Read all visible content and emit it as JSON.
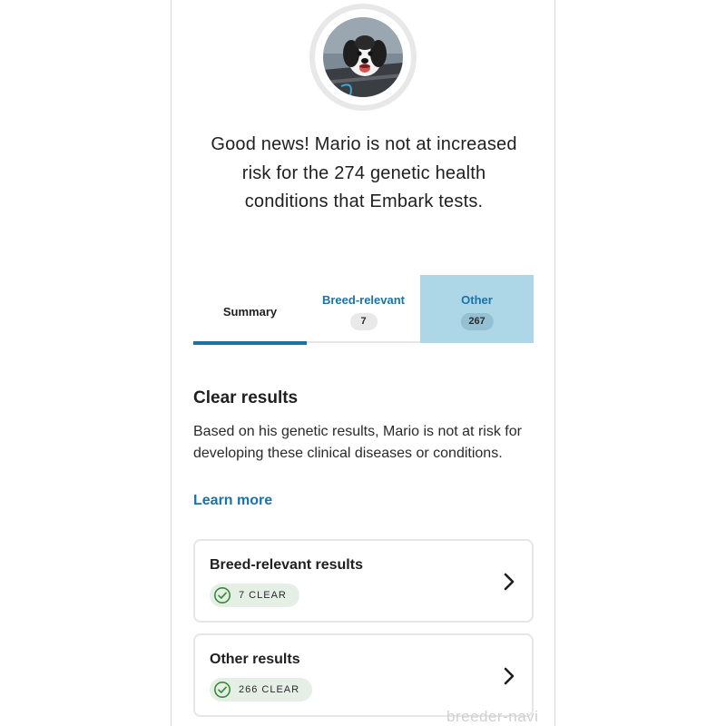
{
  "headline": "Good news! Mario is not at increased risk for the 274 genetic health conditions that Embark tests.",
  "tabs": [
    {
      "label": "Summary",
      "count": ""
    },
    {
      "label": "Breed-relevant",
      "count": "7"
    },
    {
      "label": "Other",
      "count": "267"
    }
  ],
  "clear_section": {
    "title": "Clear results",
    "body": "Based on his genetic results, Mario is not at risk for developing these clinical diseases or conditions.",
    "learn_more": "Learn more"
  },
  "cards": [
    {
      "title": "Breed-relevant results",
      "badge": "7 CLEAR"
    },
    {
      "title": "Other results",
      "badge": "266 CLEAR"
    }
  ],
  "watermark": "breeder-navi",
  "colors": {
    "accent": "#1a73a8",
    "selected_tab_bg": "#add6e6",
    "badge_bg": "#e6efe6",
    "check_green": "#3a8a3a"
  }
}
